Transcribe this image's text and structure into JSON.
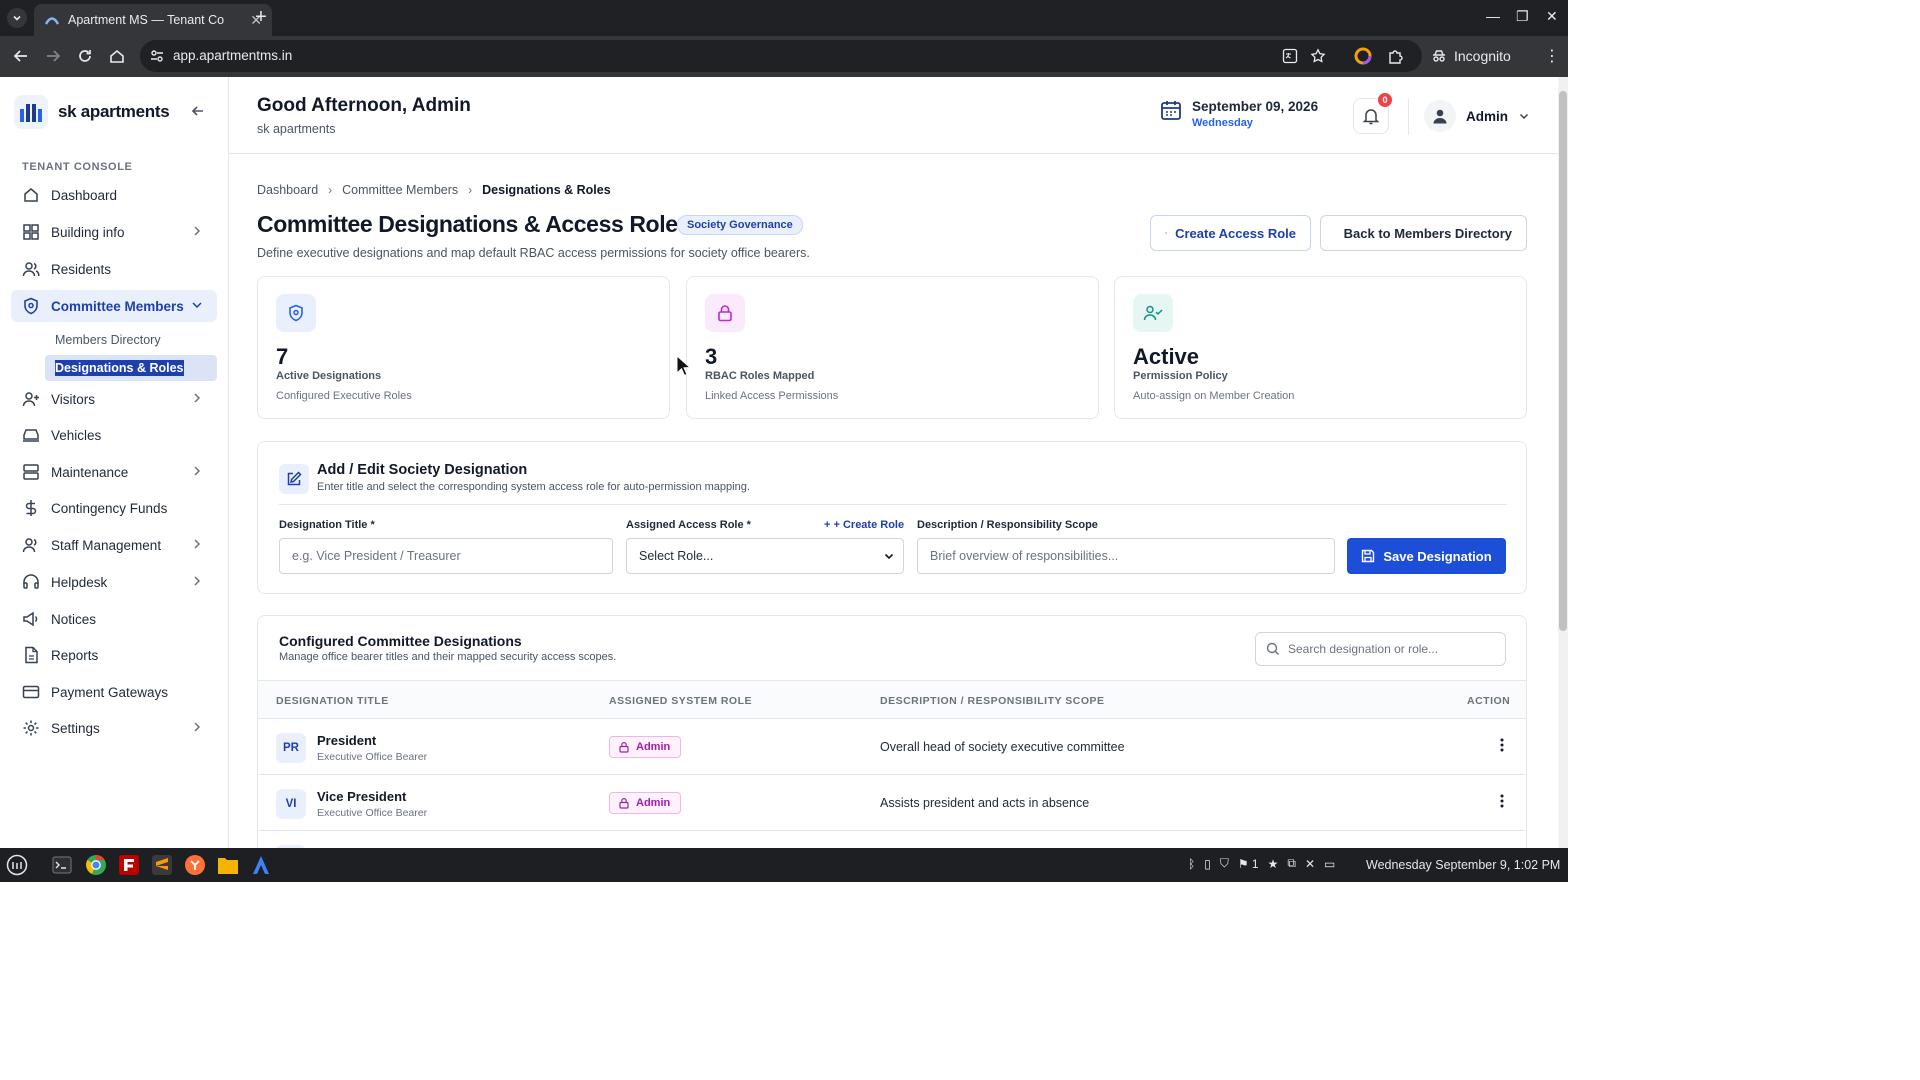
{
  "browser": {
    "tab_title": "Apartment MS — Tenant Co",
    "url": "app.apartmentms.in",
    "incognito_label": "Incognito"
  },
  "sidebar": {
    "brand": "sk apartments",
    "section_label": "TENANT CONSOLE",
    "items": [
      {
        "label": "Dashboard",
        "icon": "home-icon",
        "has_chevron": false
      },
      {
        "label": "Building info",
        "icon": "grid-icon",
        "has_chevron": true
      },
      {
        "label": "Residents",
        "icon": "users-icon",
        "has_chevron": false
      },
      {
        "label": "Committee Members",
        "icon": "shield-icon",
        "has_chevron": true,
        "active": true
      },
      {
        "label": "Visitors",
        "icon": "user-plus-icon",
        "has_chevron": true
      },
      {
        "label": "Vehicles",
        "icon": "car-icon",
        "has_chevron": false
      },
      {
        "label": "Maintenance",
        "icon": "server-icon",
        "has_chevron": true
      },
      {
        "label": "Contingency Funds",
        "icon": "dollar-icon",
        "has_chevron": false
      },
      {
        "label": "Staff Management",
        "icon": "staff-icon",
        "has_chevron": true
      },
      {
        "label": "Helpdesk",
        "icon": "headset-icon",
        "has_chevron": true
      },
      {
        "label": "Notices",
        "icon": "megaphone-icon",
        "has_chevron": false
      },
      {
        "label": "Reports",
        "icon": "file-icon",
        "has_chevron": false
      },
      {
        "label": "Payment Gateways",
        "icon": "credit-card-icon",
        "has_chevron": false
      },
      {
        "label": "Settings",
        "icon": "gear-icon",
        "has_chevron": true
      }
    ],
    "sub_items": [
      {
        "label": "Members Directory"
      },
      {
        "label": "Designations & Roles",
        "active": true
      }
    ]
  },
  "header": {
    "greeting": "Good Afternoon, Admin",
    "subtitle": "sk apartments",
    "date": "September 09, 2026",
    "weekday": "Wednesday",
    "notification_count": "0",
    "user_name": "Admin"
  },
  "main": {
    "breadcrumb": [
      "Dashboard",
      "Committee Members",
      "Designations & Roles"
    ],
    "title": "Committee Designations & Access Roles",
    "tag": "Society Governance",
    "description": "Define executive designations and map default RBAC access permissions for society office bearers.",
    "create_button": "Create Access Role",
    "back_button": "Back to Members Directory",
    "stats": [
      {
        "value": "7",
        "label": "Active Designations",
        "caption": "Configured Executive Roles",
        "icon": "shield-icon",
        "color": "#2563eb"
      },
      {
        "value": "3",
        "label": "RBAC Roles Mapped",
        "caption": "Linked Access Permissions",
        "icon": "lock-icon",
        "color": "#c026d3"
      },
      {
        "value": "Active",
        "label": "Permission Policy",
        "caption": "Auto-assign on Member Creation",
        "icon": "user-check-icon",
        "color": "#0d9488"
      }
    ],
    "form": {
      "title": "Add / Edit Society Designation",
      "subtitle": "Enter title and select the corresponding system access role for auto-permission mapping.",
      "designation_label": "Designation Title *",
      "designation_placeholder": "e.g. Vice President / Treasurer",
      "role_label": "Assigned Access Role *",
      "create_role_link": "+ Create Role",
      "role_select_value": "Select Role...",
      "description_label": "Description / Responsibility Scope",
      "description_placeholder": "Brief overview of responsibilities...",
      "save_button": "Save Designation"
    },
    "table": {
      "title": "Configured Committee Designations",
      "subtitle": "Manage office bearer titles and their mapped security access scopes.",
      "search_placeholder": "Search designation or role...",
      "columns": [
        "DESIGNATION TITLE",
        "ASSIGNED SYSTEM ROLE",
        "DESCRIPTION / RESPONSIBILITY SCOPE",
        "ACTION"
      ],
      "rows": [
        {
          "initials": "PR",
          "title": "President",
          "subtitle": "Executive Office Bearer",
          "role": "Admin",
          "description": "Overall head of society executive committee"
        },
        {
          "initials": "VI",
          "title": "Vice President",
          "subtitle": "Executive Office Bearer",
          "role": "Admin",
          "description": "Assists president and acts in absence"
        }
      ]
    }
  },
  "taskbar": {
    "clock": "Wednesday September 9, 1:02 PM",
    "workspace": "1"
  },
  "colors": {
    "accent": "#1e40af",
    "primary_button": "#1d4ed8",
    "role_badge": "#a21caf",
    "active_nav_bg": "#eaf0fb"
  }
}
